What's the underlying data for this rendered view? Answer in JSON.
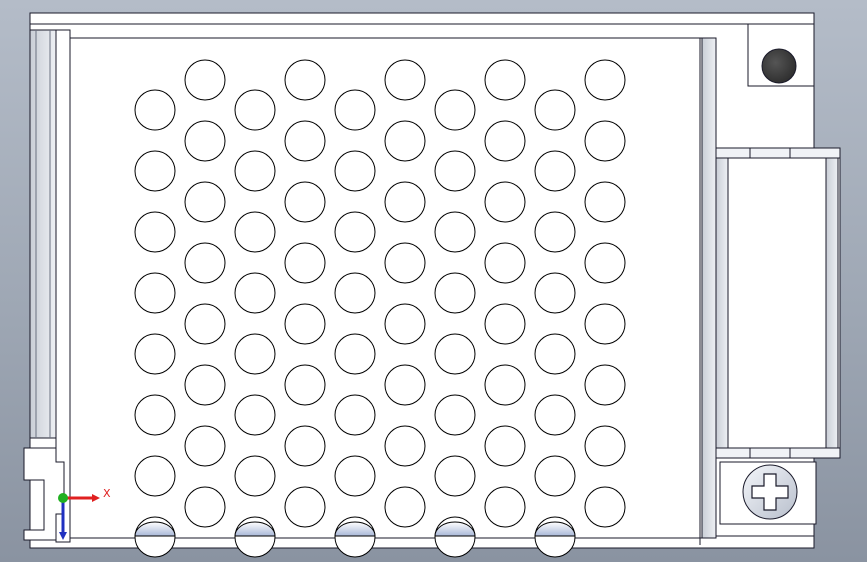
{
  "viewport": {
    "background_top": "#b4bcc8",
    "background_bottom": "#8a93a1"
  },
  "model": {
    "face_color": "#ffffff",
    "edge_color": "#1a1a2a",
    "hole_edge_color": "#000000",
    "hole_grid": {
      "columns": 10,
      "odd_rows": 8,
      "even_rows": 8
    }
  },
  "triad": {
    "x_label": "X",
    "x_color": "#e02020",
    "y_color": "#20b020",
    "z_color": "#2030c0"
  }
}
